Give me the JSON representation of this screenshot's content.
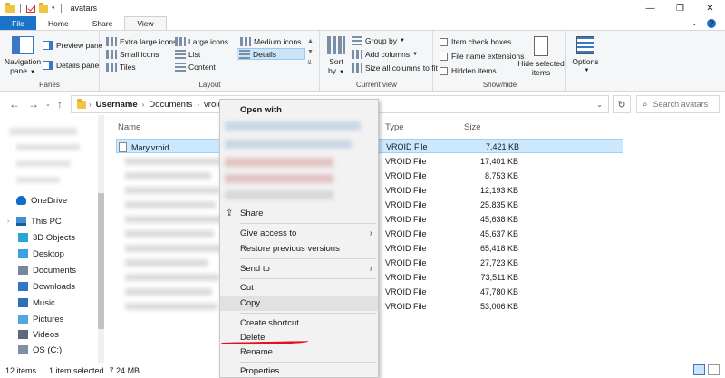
{
  "window": {
    "title": "avatars",
    "controls": [
      "—",
      "❐",
      "✕"
    ]
  },
  "tabs": [
    {
      "label": "File"
    },
    {
      "label": "Home"
    },
    {
      "label": "Share"
    },
    {
      "label": "View"
    }
  ],
  "ribbon": {
    "panes": {
      "label": "Panes",
      "navigation_pane_line1": "Navigation",
      "navigation_pane_line2": "pane",
      "preview_pane": "Preview pane",
      "details_pane": "Details pane"
    },
    "layout": {
      "label": "Layout",
      "items": [
        "Extra large icons",
        "Large icons",
        "Medium icons",
        "Small icons",
        "List",
        "Details",
        "Tiles",
        "Content"
      ],
      "selected": "Details"
    },
    "current_view": {
      "label": "Current view",
      "sort_by_line1": "Sort",
      "sort_by_line2": "by",
      "group_by": "Group by",
      "add_columns": "Add columns",
      "size_all_columns": "Size all columns to fit"
    },
    "show_hide": {
      "label": "Show/hide",
      "item_check_boxes": "Item check boxes",
      "file_name_extensions": "File name extensions",
      "hidden_items": "Hidden items",
      "hide_selected_line1": "Hide selected",
      "hide_selected_line2": "items"
    },
    "options": "Options"
  },
  "address": {
    "crumbs": [
      "Username",
      "Documents",
      "vroid"
    ],
    "search_placeholder": "Search avatars"
  },
  "nav_pane": {
    "items": [
      {
        "label": "OneDrive",
        "icon": "onedrive-icon"
      },
      {
        "label": "This PC",
        "icon": "computer-icon"
      },
      {
        "label": "3D Objects",
        "icon": "3d-objects-icon"
      },
      {
        "label": "Desktop",
        "icon": "desktop-icon"
      },
      {
        "label": "Documents",
        "icon": "documents-icon"
      },
      {
        "label": "Downloads",
        "icon": "downloads-icon"
      },
      {
        "label": "Music",
        "icon": "music-icon"
      },
      {
        "label": "Pictures",
        "icon": "pictures-icon"
      },
      {
        "label": "Videos",
        "icon": "videos-icon"
      },
      {
        "label": "OS (C:)",
        "icon": "drive-icon"
      }
    ]
  },
  "file_list": {
    "columns": {
      "name": "Name",
      "type": "Type",
      "size": "Size"
    },
    "rows": [
      {
        "name": "Mary.vroid",
        "type": "VROID File",
        "size": "7,421 KB",
        "selected": true
      },
      {
        "name": "",
        "type": "VROID File",
        "size": "17,401 KB"
      },
      {
        "name": "",
        "type": "VROID File",
        "size": "8,753 KB"
      },
      {
        "name": "",
        "type": "VROID File",
        "size": "12,193 KB"
      },
      {
        "name": "",
        "type": "VROID File",
        "size": "25,835 KB"
      },
      {
        "name": "",
        "type": "VROID File",
        "size": "45,638 KB"
      },
      {
        "name": "",
        "type": "VROID File",
        "size": "45,637 KB"
      },
      {
        "name": "",
        "type": "VROID File",
        "size": "65,418 KB"
      },
      {
        "name": "",
        "type": "VROID File",
        "size": "27,723 KB"
      },
      {
        "name": "",
        "type": "VROID File",
        "size": "73,511 KB"
      },
      {
        "name": "",
        "type": "VROID File",
        "size": "47,780 KB"
      },
      {
        "name": "",
        "type": "VROID File",
        "size": "53,006 KB"
      }
    ]
  },
  "status_bar": {
    "count": "12 items",
    "selection": "1 item selected",
    "size": "7.24 MB"
  },
  "context_menu": {
    "open_with": "Open with",
    "share": "Share",
    "give_access_to": "Give access to",
    "restore_previous_versions": "Restore previous versions",
    "send_to": "Send to",
    "cut": "Cut",
    "copy": "Copy",
    "create_shortcut": "Create shortcut",
    "delete": "Delete",
    "rename": "Rename",
    "properties": "Properties"
  },
  "colors": {
    "accent": "#1a73c9",
    "selection": "#cce8ff",
    "annotation": "#e3121c"
  }
}
